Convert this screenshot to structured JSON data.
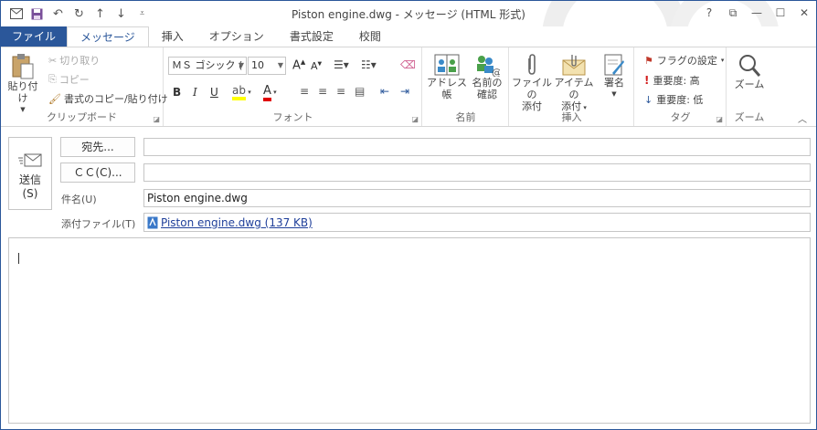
{
  "window": {
    "title": "Piston engine.dwg - メッセージ (HTML 形式)",
    "controls": {
      "help": "?",
      "restore_ribbon": "⧉",
      "minimize": "—",
      "maximize": "☐",
      "close": "✕"
    }
  },
  "tabs": [
    {
      "label": "ファイル"
    },
    {
      "label": "メッセージ"
    },
    {
      "label": "挿入"
    },
    {
      "label": "オプション"
    },
    {
      "label": "書式設定"
    },
    {
      "label": "校閲"
    }
  ],
  "ribbon": {
    "clipboard": {
      "label": "クリップボード",
      "paste": "貼り付け",
      "cut": "切り取り",
      "copy": "コピー",
      "format_painter": "書式のコピー/貼り付け"
    },
    "font": {
      "label": "フォント",
      "font_name": "ＭＳ ゴシック (",
      "font_size": "10",
      "bold": "B",
      "italic": "I",
      "underline": "U"
    },
    "names": {
      "label": "名前",
      "address_book": "アドレス帳",
      "check_names_1": "名前の",
      "check_names_2": "確認"
    },
    "insert": {
      "label": "挿入",
      "attach_file_1": "ファイルの",
      "attach_file_2": "添付",
      "attach_item_1": "アイテムの",
      "attach_item_2": "添付",
      "signature": "署名"
    },
    "tags": {
      "label": "タグ",
      "follow_up": "フラグの設定",
      "high": "重要度: 高",
      "low": "重要度: 低"
    },
    "zoom": {
      "label": "ズーム",
      "zoom": "ズーム"
    }
  },
  "compose": {
    "send_1": "送信",
    "send_2": "(S)",
    "to_button": "宛先...",
    "cc_button": "ＣＣ(C)...",
    "to_value": "",
    "cc_value": "",
    "subject_label": "件名(U)",
    "subject_value": "Piston engine.dwg",
    "attach_label": "添付ファイル(T)",
    "attachment": "Piston engine.dwg (137 KB)"
  },
  "colors": {
    "accent": "#2b579a",
    "highlight": "#ffff00",
    "font_color": "#e00000",
    "flag": "#c0392b"
  }
}
